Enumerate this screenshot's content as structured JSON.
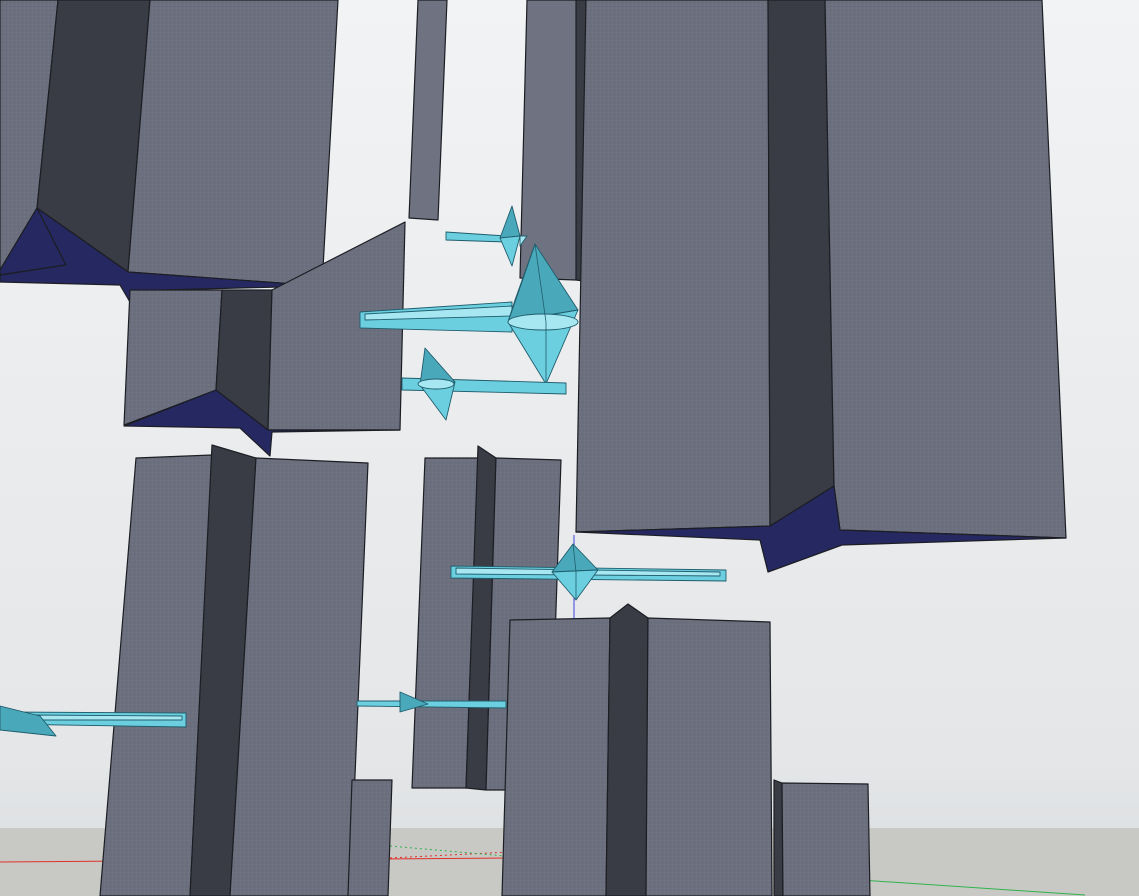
{
  "scene": {
    "colors": {
      "sky": "#eef0f2",
      "sky_bottom": "#d9dcde",
      "ground": "#c8c9c5",
      "pillar_face": "#6c707e",
      "pillar_face_light": "#727684",
      "pillar_shadow": "#3a3c45",
      "notch_fill": "#262862",
      "glass": "#6ccfe0",
      "glass_light": "#a7e7f2",
      "glass_dark": "#4aa8bb",
      "axis_red": "#e0302a",
      "axis_green": "#2fb24a",
      "axis_blue": "#3a44d8"
    },
    "icons": [
      "red-axis-line",
      "green-axis-line",
      "blue-axis-line"
    ]
  }
}
